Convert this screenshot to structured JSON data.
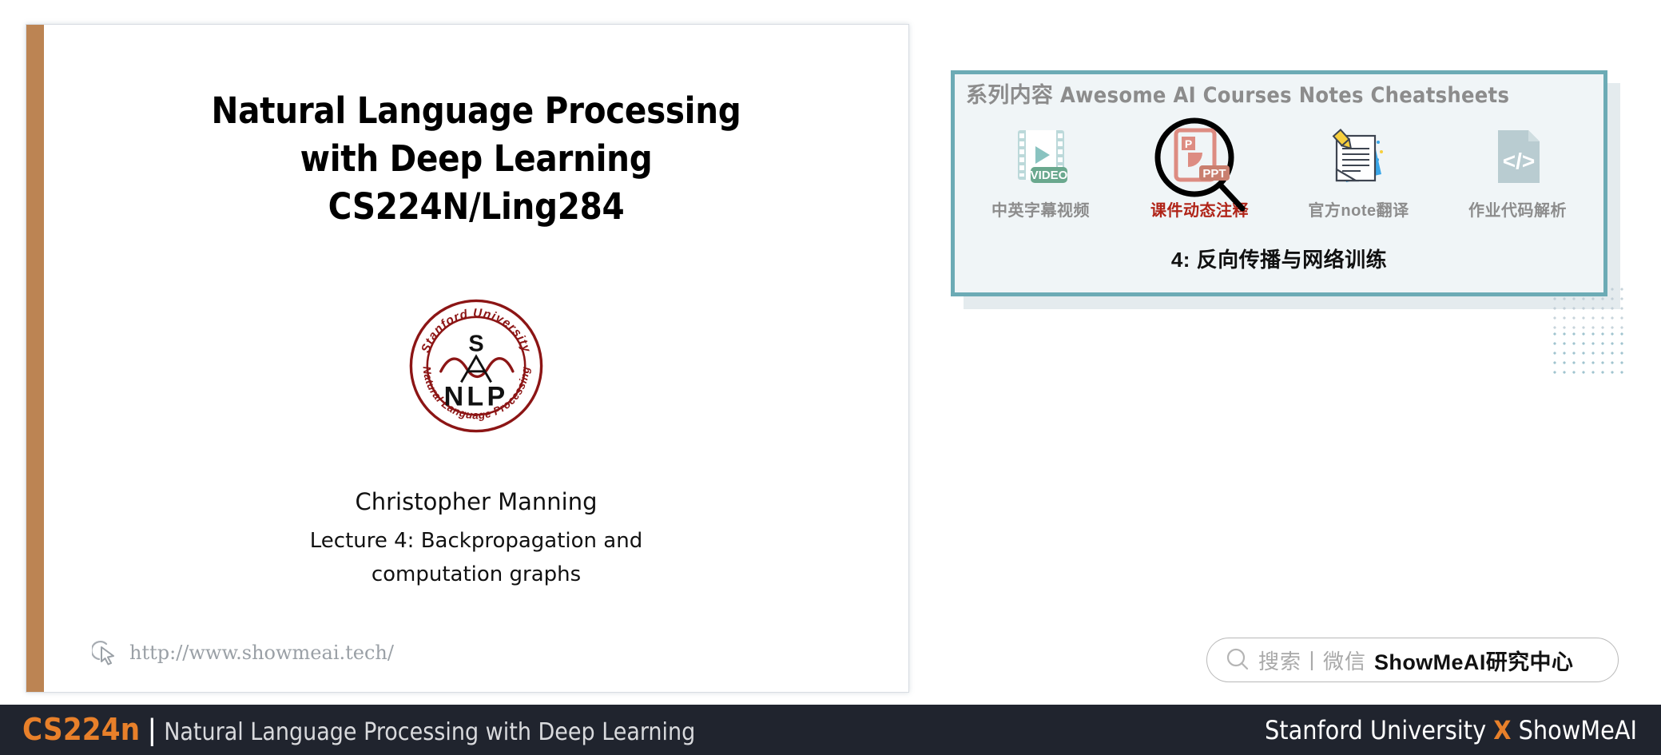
{
  "slide": {
    "title_lines": [
      "Natural Language Processing",
      "with Deep Learning",
      "CS224N/Ling284"
    ],
    "logo": {
      "top_arc": "Stanford University",
      "bottom_arc": "Natural Language Processing",
      "letter_top": "S",
      "letters_bottom": "NLP",
      "color": "#8c1515"
    },
    "author": "Christopher Manning",
    "lecture_lines": [
      "Lecture 4: Backpropagation and",
      "computation graphs"
    ],
    "url": "http://www.showmeai.tech/",
    "accent_color": "#bc8453"
  },
  "promo": {
    "title": "系列内容 Awesome AI Courses Notes Cheatsheets",
    "border_color": "#6cabb5",
    "background_color": "#f0f5f7",
    "items": [
      {
        "icon": "video-film-icon",
        "badge": "VIDEO",
        "label": "中英字幕视频",
        "highlighted": false
      },
      {
        "icon": "ppt-file-icon",
        "badge": "PPT",
        "badge2": "P",
        "label": "课件动态注释",
        "highlighted": true
      },
      {
        "icon": "note-pen-icon",
        "badge": "",
        "label": "官方note翻译",
        "highlighted": false
      },
      {
        "icon": "code-file-icon",
        "badge": "</>",
        "label": "作业代码解析",
        "highlighted": false
      }
    ],
    "highlight_color": "#b02418",
    "subtitle": "4: 反向传播与网络训练"
  },
  "search": {
    "icon": "search-icon",
    "gray_text": "搜索丨微信",
    "bold_text": "ShowMeAI研究中心"
  },
  "footer": {
    "code": "CS224n",
    "divider": "|",
    "subtitle": "Natural Language Processing with Deep Learning",
    "right_prefix": "Stanford University ",
    "right_x": "X",
    "right_suffix": " ShowMeAI",
    "background_color": "#20242e",
    "accent_color": "#e8802a"
  }
}
